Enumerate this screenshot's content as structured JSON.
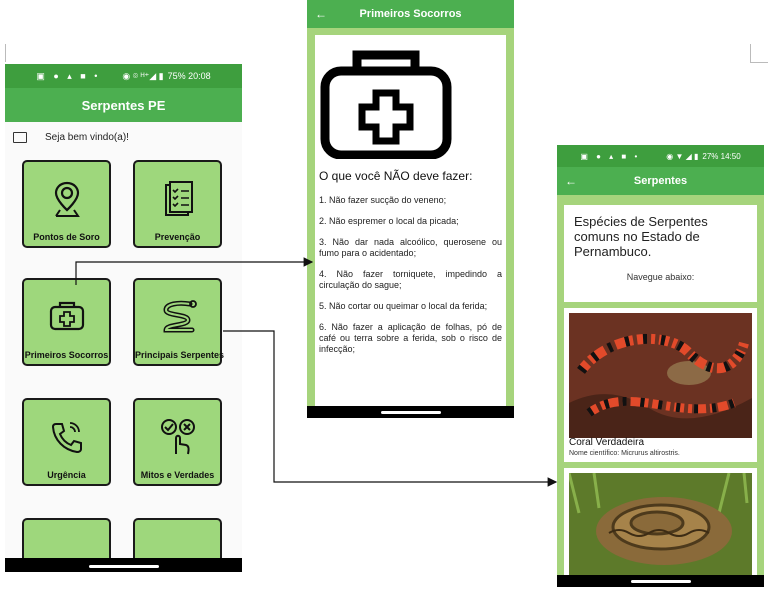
{
  "phone1": {
    "status": "75% 20:08",
    "title": "Serpentes PE",
    "welcome": "Seja bem vindo(a)!",
    "tiles": [
      {
        "label": "Pontos de Soro",
        "icon": "map-pin-icon"
      },
      {
        "label": "Prevenção",
        "icon": "checklist-icon"
      },
      {
        "label": "Primeiros Socorros",
        "icon": "first-aid-kit-icon"
      },
      {
        "label": "Principais Serpentes",
        "icon": "snake-icon"
      },
      {
        "label": "Urgência",
        "icon": "phone-call-icon"
      },
      {
        "label": "Mitos e Verdades",
        "icon": "true-false-icon"
      }
    ]
  },
  "phone2": {
    "title": "Primeiros Socorros",
    "heading": "O que você NÃO deve fazer:",
    "items": [
      "1. Não fazer sucção do veneno;",
      "2. Não espremer o local da picada;",
      "3. Não dar nada alcoólico, querosene ou fumo para o acidentado;",
      "4. Não fazer torniquete, impedindo a circulação do sague;",
      "5. Não cortar ou queimar o local da ferida;",
      "6. Não fazer a aplicação de folhas, pó de café ou terra sobre a ferida, sob o risco de infecção;"
    ]
  },
  "phone3": {
    "status": "27% 14:50",
    "title": "Serpentes",
    "heading": "Espécies de Serpentes comuns no Estado de Pernambuco.",
    "sub": "Navegue abaixo:",
    "snakes": [
      {
        "name": "Coral Verdadeira",
        "sci": "Nome científico: Micrurus altirostris."
      }
    ]
  },
  "colors": {
    "appbar": "#4caf50",
    "statusbar": "#3e9e3e",
    "tile": "#9ed77c",
    "bg_green": "#a6d47c"
  }
}
